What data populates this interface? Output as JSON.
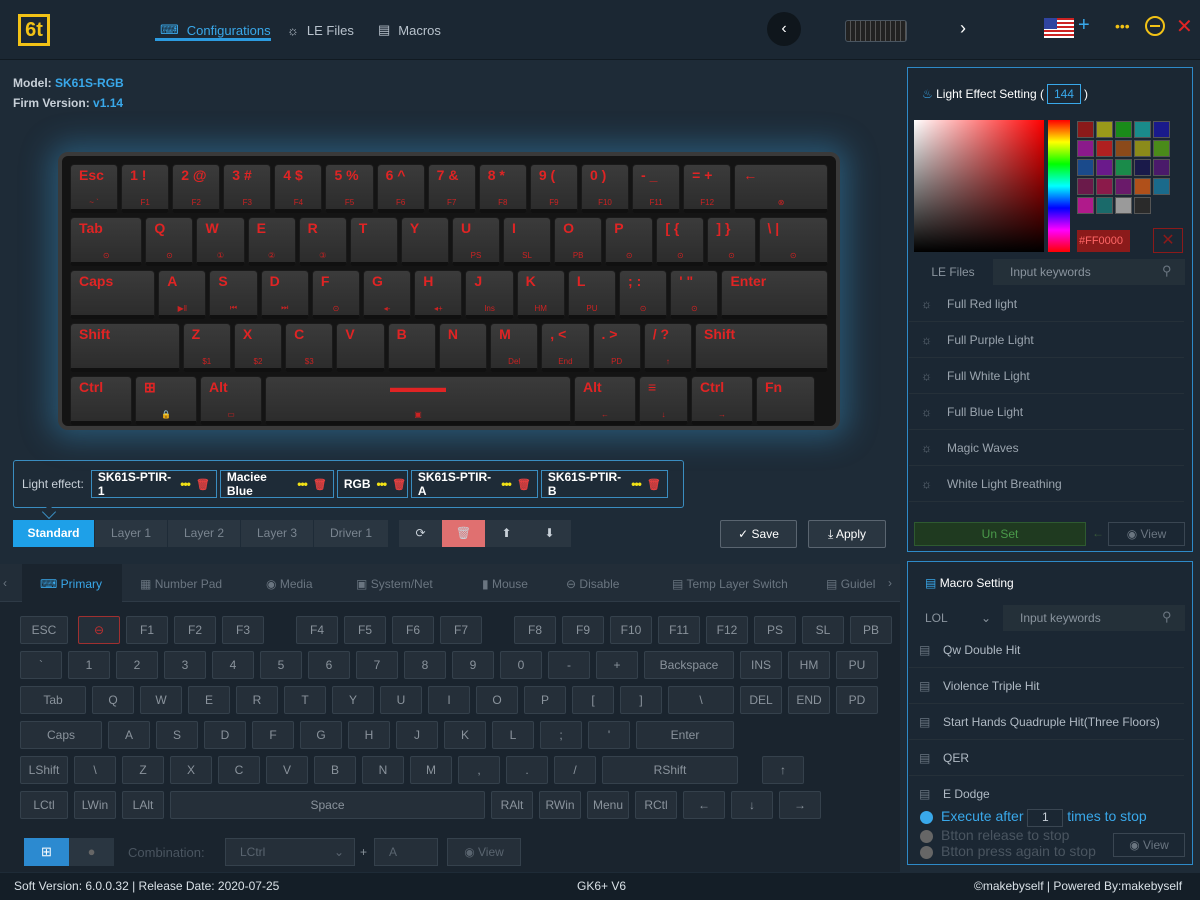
{
  "topbar": {
    "logo": "6t",
    "tabs": [
      "Configurations",
      "LE Files",
      "Macros"
    ],
    "prev": "‹",
    "next": "›",
    "add": "+",
    "more": "•••"
  },
  "info": {
    "model_label": "Model:",
    "model": "SK61S-RGB",
    "firm_label": "Firm Version:",
    "firm": "v1.14"
  },
  "keyboard": {
    "rows": [
      [
        {
          "l": "Esc",
          "s": "~ `",
          "w": 49
        },
        {
          "l": "1 !",
          "s": "F1",
          "w": 49
        },
        {
          "l": "2 @",
          "s": "F2",
          "w": 49
        },
        {
          "l": "3 #",
          "s": "F3",
          "w": 49
        },
        {
          "l": "4 $",
          "s": "F4",
          "w": 49
        },
        {
          "l": "5 %",
          "s": "F5",
          "w": 49
        },
        {
          "l": "6 ^",
          "s": "F6",
          "w": 49
        },
        {
          "l": "7 &",
          "s": "F7",
          "w": 49
        },
        {
          "l": "8 *",
          "s": "F8",
          "w": 49
        },
        {
          "l": "9 (",
          "s": "F9",
          "w": 49
        },
        {
          "l": "0 )",
          "s": "F10",
          "w": 49
        },
        {
          "l": "- _",
          "s": "F11",
          "w": 49
        },
        {
          "l": "= +",
          "s": "F12",
          "w": 49
        },
        {
          "l": "←",
          "s": "⊗",
          "w": 96
        }
      ],
      [
        {
          "l": "Tab",
          "s": "⊙",
          "w": 74
        },
        {
          "l": "Q",
          "s": "⊙",
          "w": 49
        },
        {
          "l": "W",
          "s": "①",
          "w": 49
        },
        {
          "l": "E",
          "s": "②",
          "w": 49
        },
        {
          "l": "R",
          "s": "③",
          "w": 49
        },
        {
          "l": "T",
          "s": "",
          "w": 49
        },
        {
          "l": "Y",
          "s": "",
          "w": 49
        },
        {
          "l": "U",
          "s": "PS",
          "w": 49
        },
        {
          "l": "I",
          "s": "SL",
          "w": 49
        },
        {
          "l": "O",
          "s": "PB",
          "w": 49
        },
        {
          "l": "P",
          "s": "⊙",
          "w": 49
        },
        {
          "l": "[ {",
          "s": "⊙",
          "w": 49
        },
        {
          "l": "] }",
          "s": "⊙",
          "w": 49
        },
        {
          "l": "\\ |",
          "s": "⊙",
          "w": 71
        }
      ],
      [
        {
          "l": "Caps",
          "s": "",
          "w": 87
        },
        {
          "l": "A",
          "s": "▶‖",
          "w": 49
        },
        {
          "l": "S",
          "s": "⏮",
          "w": 49
        },
        {
          "l": "D",
          "s": "⏭",
          "w": 49
        },
        {
          "l": "F",
          "s": "⊙",
          "w": 49
        },
        {
          "l": "G",
          "s": "◂-",
          "w": 49
        },
        {
          "l": "H",
          "s": "◂+",
          "w": 49
        },
        {
          "l": "J",
          "s": "Ins",
          "w": 49
        },
        {
          "l": "K",
          "s": "HM",
          "w": 49
        },
        {
          "l": "L",
          "s": "PU",
          "w": 49
        },
        {
          "l": "; :",
          "s": "⊙",
          "w": 49
        },
        {
          "l": "' \"",
          "s": "⊙",
          "w": 49
        },
        {
          "l": "Enter",
          "s": "",
          "w": 109
        }
      ],
      [
        {
          "l": "Shift",
          "s": "",
          "w": 112
        },
        {
          "l": "Z",
          "s": "$1",
          "w": 49
        },
        {
          "l": "X",
          "s": "$2",
          "w": 49
        },
        {
          "l": "C",
          "s": "$3",
          "w": 49
        },
        {
          "l": "V",
          "s": "",
          "w": 49
        },
        {
          "l": "B",
          "s": "",
          "w": 49
        },
        {
          "l": "N",
          "s": "",
          "w": 49
        },
        {
          "l": "M",
          "s": "Del",
          "w": 49
        },
        {
          "l": ", <",
          "s": "End",
          "w": 49
        },
        {
          "l": ". >",
          "s": "PD",
          "w": 49
        },
        {
          "l": "/ ?",
          "s": "↑",
          "w": 49
        },
        {
          "l": "Shift",
          "s": "",
          "w": 136
        }
      ],
      [
        {
          "l": "Ctrl",
          "s": "",
          "w": 62
        },
        {
          "l": "⊞",
          "s": "🔒",
          "w": 62
        },
        {
          "l": "Alt",
          "s": "▭",
          "w": 62
        },
        {
          "l": "▬▬▬▬",
          "s": "▣",
          "w": 306
        },
        {
          "l": "Alt",
          "s": "←",
          "w": 62
        },
        {
          "l": "≡",
          "s": "↓",
          "w": 49
        },
        {
          "l": "Ctrl",
          "s": "→",
          "w": 62
        },
        {
          "l": "Fn",
          "s": "",
          "w": 59
        }
      ]
    ]
  },
  "light_effect": {
    "label": "Light effect:",
    "chips": [
      "SK61S-PTIR-1",
      "Maciee Blue",
      "RGB",
      "SK61S-PTIR-A",
      "SK61S-PTIR-B"
    ],
    "dots": "•••",
    "trash": "🗑"
  },
  "layers": [
    "Standard",
    "Layer 1",
    "Layer 2",
    "Layer 3",
    "Driver 1"
  ],
  "tools": [
    "⟳",
    "🗑",
    "⬆",
    "⬇"
  ],
  "actions": {
    "save": "✓  Save",
    "apply": "⤓  Apply"
  },
  "bottom_tabs": [
    "Primary",
    "Number Pad",
    "Media",
    "System/Net",
    "Mouse",
    "Disable",
    "Temp Layer Switch",
    "Guidel"
  ],
  "vkeys": [
    [
      [
        "ESC",
        48
      ],
      [
        "⊖",
        42,
        1
      ],
      [
        "F1",
        42,
        1
      ],
      [
        "F2",
        42
      ],
      [
        "F3",
        42
      ],
      [
        "F4",
        42,
        2
      ],
      [
        "F5",
        42
      ],
      [
        "F6",
        42
      ],
      [
        "F7",
        42
      ],
      [
        "F8",
        42,
        2
      ],
      [
        "F9",
        42
      ],
      [
        "F10",
        42
      ],
      [
        "F11",
        42
      ],
      [
        "F12",
        42
      ],
      [
        "PS",
        42
      ],
      [
        "SL",
        42
      ],
      [
        "PB",
        42
      ]
    ],
    [
      [
        "`",
        42
      ],
      [
        "1",
        42
      ],
      [
        "2",
        42
      ],
      [
        "3",
        42
      ],
      [
        "4",
        42
      ],
      [
        "5",
        42
      ],
      [
        "6",
        42
      ],
      [
        "7",
        42
      ],
      [
        "8",
        42
      ],
      [
        "9",
        42
      ],
      [
        "0",
        42
      ],
      [
        "-",
        42
      ],
      [
        "+",
        42
      ],
      [
        "Backspace",
        90
      ],
      [
        "INS",
        42
      ],
      [
        "HM",
        42
      ],
      [
        "PU",
        42
      ]
    ],
    [
      [
        "Tab",
        66
      ],
      [
        "Q",
        42
      ],
      [
        "W",
        42
      ],
      [
        "E",
        42
      ],
      [
        "R",
        42
      ],
      [
        "T",
        42
      ],
      [
        "Y",
        42
      ],
      [
        "U",
        42
      ],
      [
        "I",
        42
      ],
      [
        "O",
        42
      ],
      [
        "P",
        42
      ],
      [
        "[",
        42
      ],
      [
        "]",
        42
      ],
      [
        "\\",
        66
      ],
      [
        "DEL",
        42
      ],
      [
        "END",
        42
      ],
      [
        "PD",
        42
      ]
    ],
    [
      [
        "Caps",
        82
      ],
      [
        "A",
        42
      ],
      [
        "S",
        42
      ],
      [
        "D",
        42
      ],
      [
        "F",
        42
      ],
      [
        "G",
        42
      ],
      [
        "H",
        42
      ],
      [
        "J",
        42
      ],
      [
        "K",
        42
      ],
      [
        "L",
        42
      ],
      [
        ";",
        42
      ],
      [
        "'",
        42
      ],
      [
        "Enter",
        98
      ]
    ],
    [
      [
        "LShift",
        48
      ],
      [
        "\\",
        42
      ],
      [
        "Z",
        42
      ],
      [
        "X",
        42
      ],
      [
        "C",
        42
      ],
      [
        "V",
        42
      ],
      [
        "B",
        42
      ],
      [
        "N",
        42
      ],
      [
        "M",
        42
      ],
      [
        ",",
        42
      ],
      [
        ".",
        42
      ],
      [
        "/",
        42
      ],
      [
        "RShift",
        136
      ],
      [
        "↑",
        42
      ]
    ],
    [
      [
        "LCtl",
        48
      ],
      [
        "LWin",
        42
      ],
      [
        "LAlt",
        42
      ],
      [
        "Space",
        315
      ],
      [
        "RAlt",
        42
      ],
      [
        "RWin",
        42
      ],
      [
        "Menu",
        42
      ],
      [
        "RCtl",
        42
      ],
      [
        "←",
        42
      ],
      [
        "↓",
        42
      ],
      [
        "→",
        42
      ]
    ]
  ],
  "combination": {
    "label": "Combination:",
    "mod": "LCtrl",
    "plus": "+",
    "key": "A",
    "view": "View"
  },
  "light_panel": {
    "title": "Light Effect Setting (",
    "count": "144",
    "close": ")",
    "hex": "#FF0000",
    "tab1": "LE Files",
    "search": "Input keywords",
    "items": [
      "Full Red light",
      "Full Purple Light",
      "Full White Light",
      "Full Blue Light",
      "Magic Waves",
      "White Light Breathing"
    ],
    "unset": "Un Set",
    "view": "View"
  },
  "swatches": [
    "#8b1a1a",
    "#9a9a1a",
    "#1a8b1a",
    "#1a8b8b",
    "#1a1a8b",
    "#8b1a8b",
    "#b02020",
    "#8b4a1a",
    "#8b8b1a",
    "#4a8b1a",
    "#1a4a8b",
    "#6a1a8b",
    "#1a8b4a",
    "#1a1a4a",
    "#4a1a6a",
    "#6a1a4a",
    "#8b1a4a",
    "#6a1a6a",
    "#b0501a",
    "#1a6a8b",
    "#b01a8b",
    "#1a6a6a",
    "#9a9a9a",
    "#2a2a2a"
  ],
  "macro_panel": {
    "title": "Macro Setting",
    "select": "LOL",
    "search": "Input keywords",
    "items": [
      "Qw Double Hit",
      "Violence Triple Hit",
      "Start Hands Quadruple Hit(Three Floors)",
      "QER",
      "E Dodge"
    ],
    "exec1": "Execute after",
    "exec_n": "1",
    "exec2": "times to stop",
    "opt2": "Btton release to stop",
    "opt3": "Btton press again to stop",
    "view": "View"
  },
  "status": {
    "left": "Soft Version: 6.0.0.32  |  Release Date: 2020-07-25",
    "center": "GK6+ V6",
    "right": "©makebyself  |  Powered By:makebyself"
  }
}
